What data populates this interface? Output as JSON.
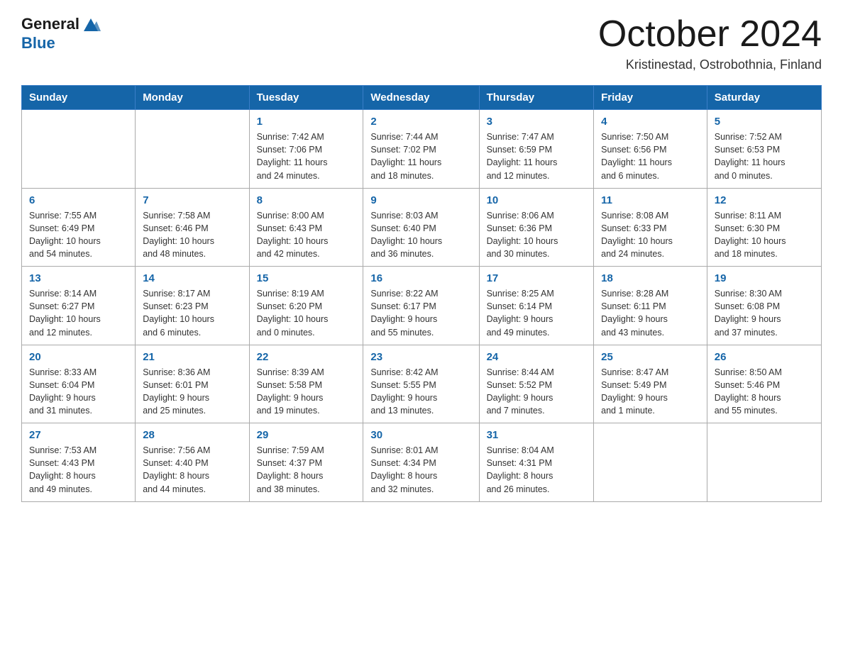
{
  "header": {
    "logo_text_general": "General",
    "logo_text_blue": "Blue",
    "month_year": "October 2024",
    "location": "Kristinestad, Ostrobothnia, Finland"
  },
  "days_of_week": [
    "Sunday",
    "Monday",
    "Tuesday",
    "Wednesday",
    "Thursday",
    "Friday",
    "Saturday"
  ],
  "weeks": [
    [
      {
        "day": "",
        "info": ""
      },
      {
        "day": "",
        "info": ""
      },
      {
        "day": "1",
        "info": "Sunrise: 7:42 AM\nSunset: 7:06 PM\nDaylight: 11 hours\nand 24 minutes."
      },
      {
        "day": "2",
        "info": "Sunrise: 7:44 AM\nSunset: 7:02 PM\nDaylight: 11 hours\nand 18 minutes."
      },
      {
        "day": "3",
        "info": "Sunrise: 7:47 AM\nSunset: 6:59 PM\nDaylight: 11 hours\nand 12 minutes."
      },
      {
        "day": "4",
        "info": "Sunrise: 7:50 AM\nSunset: 6:56 PM\nDaylight: 11 hours\nand 6 minutes."
      },
      {
        "day": "5",
        "info": "Sunrise: 7:52 AM\nSunset: 6:53 PM\nDaylight: 11 hours\nand 0 minutes."
      }
    ],
    [
      {
        "day": "6",
        "info": "Sunrise: 7:55 AM\nSunset: 6:49 PM\nDaylight: 10 hours\nand 54 minutes."
      },
      {
        "day": "7",
        "info": "Sunrise: 7:58 AM\nSunset: 6:46 PM\nDaylight: 10 hours\nand 48 minutes."
      },
      {
        "day": "8",
        "info": "Sunrise: 8:00 AM\nSunset: 6:43 PM\nDaylight: 10 hours\nand 42 minutes."
      },
      {
        "day": "9",
        "info": "Sunrise: 8:03 AM\nSunset: 6:40 PM\nDaylight: 10 hours\nand 36 minutes."
      },
      {
        "day": "10",
        "info": "Sunrise: 8:06 AM\nSunset: 6:36 PM\nDaylight: 10 hours\nand 30 minutes."
      },
      {
        "day": "11",
        "info": "Sunrise: 8:08 AM\nSunset: 6:33 PM\nDaylight: 10 hours\nand 24 minutes."
      },
      {
        "day": "12",
        "info": "Sunrise: 8:11 AM\nSunset: 6:30 PM\nDaylight: 10 hours\nand 18 minutes."
      }
    ],
    [
      {
        "day": "13",
        "info": "Sunrise: 8:14 AM\nSunset: 6:27 PM\nDaylight: 10 hours\nand 12 minutes."
      },
      {
        "day": "14",
        "info": "Sunrise: 8:17 AM\nSunset: 6:23 PM\nDaylight: 10 hours\nand 6 minutes."
      },
      {
        "day": "15",
        "info": "Sunrise: 8:19 AM\nSunset: 6:20 PM\nDaylight: 10 hours\nand 0 minutes."
      },
      {
        "day": "16",
        "info": "Sunrise: 8:22 AM\nSunset: 6:17 PM\nDaylight: 9 hours\nand 55 minutes."
      },
      {
        "day": "17",
        "info": "Sunrise: 8:25 AM\nSunset: 6:14 PM\nDaylight: 9 hours\nand 49 minutes."
      },
      {
        "day": "18",
        "info": "Sunrise: 8:28 AM\nSunset: 6:11 PM\nDaylight: 9 hours\nand 43 minutes."
      },
      {
        "day": "19",
        "info": "Sunrise: 8:30 AM\nSunset: 6:08 PM\nDaylight: 9 hours\nand 37 minutes."
      }
    ],
    [
      {
        "day": "20",
        "info": "Sunrise: 8:33 AM\nSunset: 6:04 PM\nDaylight: 9 hours\nand 31 minutes."
      },
      {
        "day": "21",
        "info": "Sunrise: 8:36 AM\nSunset: 6:01 PM\nDaylight: 9 hours\nand 25 minutes."
      },
      {
        "day": "22",
        "info": "Sunrise: 8:39 AM\nSunset: 5:58 PM\nDaylight: 9 hours\nand 19 minutes."
      },
      {
        "day": "23",
        "info": "Sunrise: 8:42 AM\nSunset: 5:55 PM\nDaylight: 9 hours\nand 13 minutes."
      },
      {
        "day": "24",
        "info": "Sunrise: 8:44 AM\nSunset: 5:52 PM\nDaylight: 9 hours\nand 7 minutes."
      },
      {
        "day": "25",
        "info": "Sunrise: 8:47 AM\nSunset: 5:49 PM\nDaylight: 9 hours\nand 1 minute."
      },
      {
        "day": "26",
        "info": "Sunrise: 8:50 AM\nSunset: 5:46 PM\nDaylight: 8 hours\nand 55 minutes."
      }
    ],
    [
      {
        "day": "27",
        "info": "Sunrise: 7:53 AM\nSunset: 4:43 PM\nDaylight: 8 hours\nand 49 minutes."
      },
      {
        "day": "28",
        "info": "Sunrise: 7:56 AM\nSunset: 4:40 PM\nDaylight: 8 hours\nand 44 minutes."
      },
      {
        "day": "29",
        "info": "Sunrise: 7:59 AM\nSunset: 4:37 PM\nDaylight: 8 hours\nand 38 minutes."
      },
      {
        "day": "30",
        "info": "Sunrise: 8:01 AM\nSunset: 4:34 PM\nDaylight: 8 hours\nand 32 minutes."
      },
      {
        "day": "31",
        "info": "Sunrise: 8:04 AM\nSunset: 4:31 PM\nDaylight: 8 hours\nand 26 minutes."
      },
      {
        "day": "",
        "info": ""
      },
      {
        "day": "",
        "info": ""
      }
    ]
  ]
}
